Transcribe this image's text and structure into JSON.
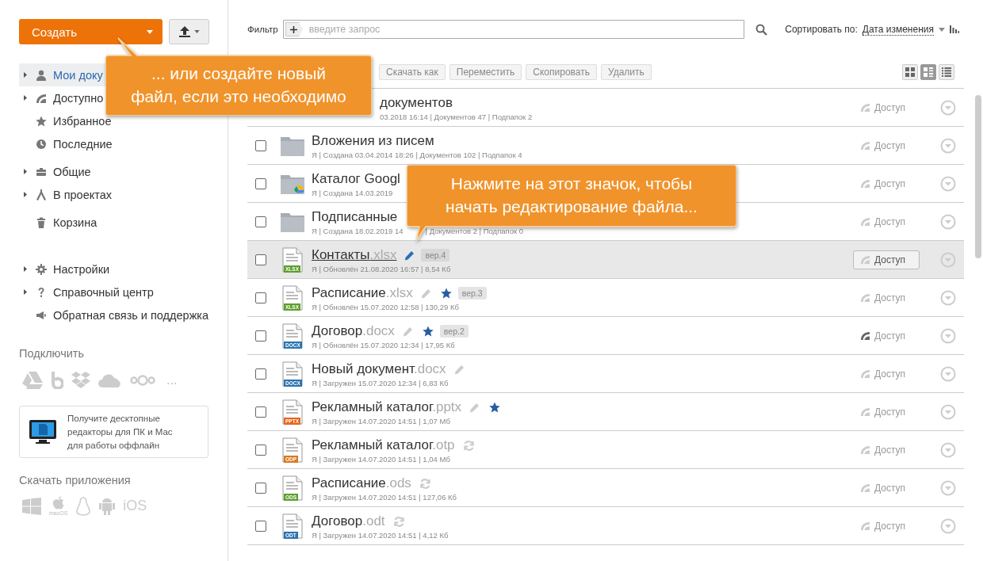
{
  "create_button": {
    "label": "Создать"
  },
  "filter": {
    "label": "Фильтр",
    "placeholder": "введите запрос"
  },
  "sort": {
    "label": "Сортировать по:",
    "value": "Дата изменения"
  },
  "sidebar": {
    "groups": [
      {
        "items": [
          {
            "label": "Мои доку",
            "expandable": true,
            "selected": true
          },
          {
            "label": "Доступно",
            "expandable": true,
            "selected": false
          },
          {
            "label": "Избранное",
            "expandable": false,
            "selected": false
          },
          {
            "label": "Последние",
            "expandable": false,
            "selected": false
          }
        ]
      },
      {
        "items": [
          {
            "label": "Общие",
            "expandable": true,
            "selected": false
          },
          {
            "label": "В проектах",
            "expandable": true,
            "selected": false
          }
        ]
      },
      {
        "items": [
          {
            "label": "Корзина",
            "expandable": false,
            "selected": false
          }
        ]
      },
      {
        "items": [
          {
            "label": "Настройки",
            "expandable": true,
            "selected": false
          },
          {
            "label": "Справочный центр",
            "expandable": true,
            "selected": false
          },
          {
            "label": "Обратная связь и поддержка",
            "expandable": false,
            "selected": false
          }
        ]
      }
    ],
    "connect": {
      "title": "Подключить",
      "more": "..."
    },
    "desktop_promo": "Получите десктопные редакторы для ПК и Mac для работы оффлайн",
    "apps": {
      "title": "Скачать приложения",
      "macos": "macOS",
      "ios": "iOS"
    }
  },
  "toolbar": {
    "buttons": [
      "Скачать как",
      "Переместить",
      "Скопировать",
      "Удалить"
    ],
    "views": [
      {
        "selected": false
      },
      {
        "selected": true
      },
      {
        "selected": false
      }
    ]
  },
  "rows": [
    {
      "kind": "partial",
      "name": "документов",
      "meta": "03.2018 16:14 | Документов 47 | Подпапок 2",
      "access": "Доступ",
      "shared": false,
      "hovered": false
    },
    {
      "kind": "folder",
      "cloud": false,
      "name": "Вложения из писем",
      "meta": "Я | Создана 03.04.2014 18:26 | Документов 102 | Подпапок 4",
      "access": "Доступ",
      "shared": false,
      "hovered": false
    },
    {
      "kind": "folder",
      "cloud": true,
      "name": "Каталог Googl",
      "meta": "Я | Создана 14.03.2019",
      "access": "Доступ",
      "shared": false,
      "hovered": false
    },
    {
      "kind": "folder",
      "cloud": false,
      "name": "Подписанные",
      "meta": "Я | Создана 18.02.2019 14",
      "meta_tail": "| Документов 2 | Подпапок 0",
      "access": "Доступ",
      "shared": false,
      "hovered": false
    },
    {
      "kind": "file",
      "name": "Контакты",
      "ext": ".xlsx",
      "badge": "XLSX",
      "color": "#5b9f2b",
      "editing": true,
      "favorite": false,
      "version": "вер.4",
      "meta": "Я | Обновлён 21.08.2020 16:57 | 8,54 Кб",
      "access": "Доступ",
      "shared": false,
      "hovered": true
    },
    {
      "kind": "file",
      "name": "Расписание",
      "ext": ".xlsx",
      "badge": "XLSX",
      "color": "#5b9f2b",
      "editing": false,
      "favorite": true,
      "version": "вер.3",
      "meta": "Я | Обновлён 15.07.2020 12:58 | 130,29 Кб",
      "access": "Доступ",
      "shared": false,
      "hovered": false
    },
    {
      "kind": "file",
      "name": "Договор",
      "ext": ".docx",
      "badge": "DOCX",
      "color": "#2a73b0",
      "editing": false,
      "favorite": true,
      "version": "вер.2",
      "meta": "Я | Обновлён 15.07.2020 12:34 | 17,95 Кб",
      "access": "Доступ",
      "shared": true,
      "hovered": false
    },
    {
      "kind": "file",
      "name": "Новый документ",
      "ext": ".docx",
      "badge": "DOCX",
      "color": "#2a73b0",
      "editing": false,
      "favorite": false,
      "meta": "Я | Загружен 15.07.2020 12:34 | 6,83 Кб",
      "access": "Доступ",
      "shared": false,
      "hovered": false
    },
    {
      "kind": "file",
      "name": "Рекламный каталог",
      "ext": ".pptx",
      "badge": "PPTX",
      "color": "#e8631c",
      "editing": false,
      "favorite": true,
      "meta": "Я | Загружен 14.07.2020 14:51 | 1,07 Мб",
      "access": "Доступ",
      "shared": false,
      "hovered": false
    },
    {
      "kind": "file",
      "name": "Рекламный каталог",
      "ext": ".otp",
      "badge": "ODP",
      "color": "#d9791e",
      "convertible": true,
      "favorite": false,
      "meta": "Я | Загружен 14.07.2020 14:51 | 1,04 Мб",
      "access": "Доступ",
      "shared": false,
      "hovered": false
    },
    {
      "kind": "file",
      "name": "Расписание",
      "ext": ".ods",
      "badge": "ODS",
      "color": "#5b9f2b",
      "convertible": true,
      "favorite": false,
      "meta": "Я | Загружен 14.07.2020 14:51 | 127,06 Кб",
      "access": "Доступ",
      "shared": false,
      "hovered": false
    },
    {
      "kind": "file",
      "name": "Договор",
      "ext": ".odt",
      "badge": "ODT",
      "color": "#2a73b0",
      "convertible": true,
      "favorite": false,
      "meta": "Я | Загружен 14.07.2020 14:51 | 4,12 Кб",
      "access": "Доступ",
      "shared": false,
      "hovered": false
    }
  ],
  "callouts": [
    {
      "text": "... или создайте новый файл, если это необходимо"
    },
    {
      "text": "Нажмите на этот значок, чтобы начать редактирование файла..."
    }
  ]
}
